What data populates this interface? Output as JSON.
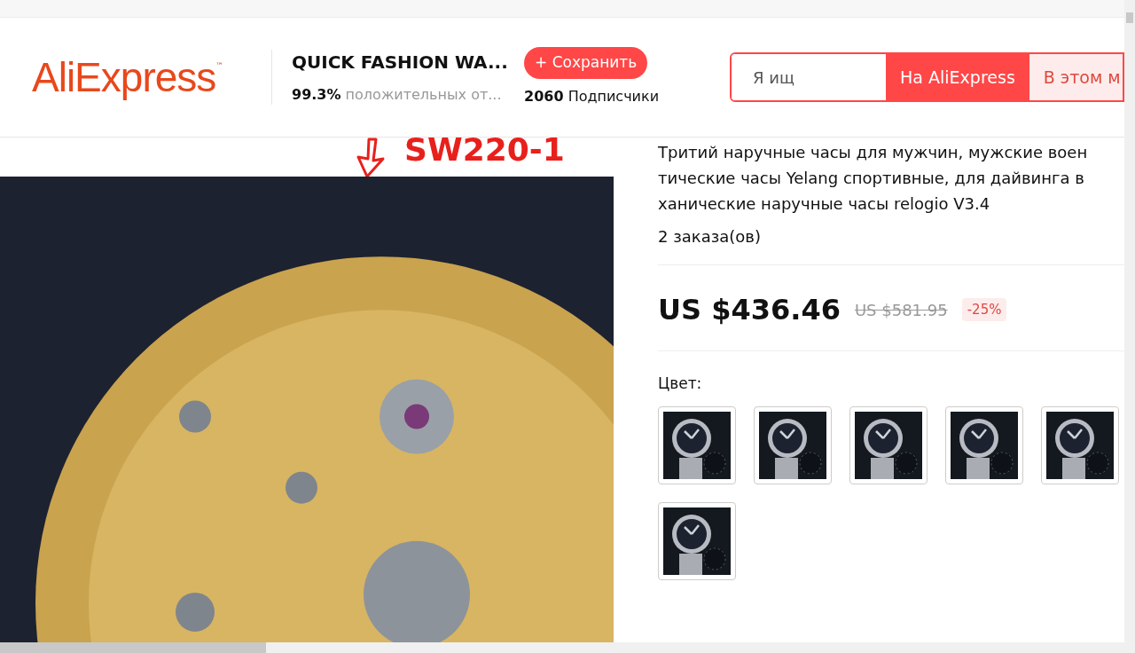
{
  "header": {
    "logo": {
      "text": "AliExpress",
      "mark": "™"
    },
    "store": {
      "name": "QUICK FASHION WA...",
      "rating": "99.3%",
      "rating_label": "положительных от...",
      "save_button": "+ Сохранить",
      "followers": "2060",
      "followers_label": "Подписчики"
    },
    "search": {
      "value": "Я ищ",
      "scopes": [
        {
          "label": "На AliExpress",
          "selected": true
        },
        {
          "label": "В этом м",
          "selected": false
        }
      ]
    }
  },
  "gallery": {
    "annotation": "SW220-1"
  },
  "product": {
    "title_lines": [
      "Тритий наручные часы для мужчин, мужские воен",
      "тические часы Yelang спортивные, для дайвинга в",
      "ханические наручные часы relogio V3.4"
    ],
    "orders": "2 заказа(ов)",
    "price": "US $436.46",
    "old_price": "US $581.95",
    "discount": "-25%",
    "color_label": "Цвет:",
    "colors": [
      {
        "selected": false
      },
      {
        "selected": false
      },
      {
        "selected": false
      },
      {
        "selected": false
      },
      {
        "selected": false
      },
      {
        "selected": false
      }
    ]
  }
}
